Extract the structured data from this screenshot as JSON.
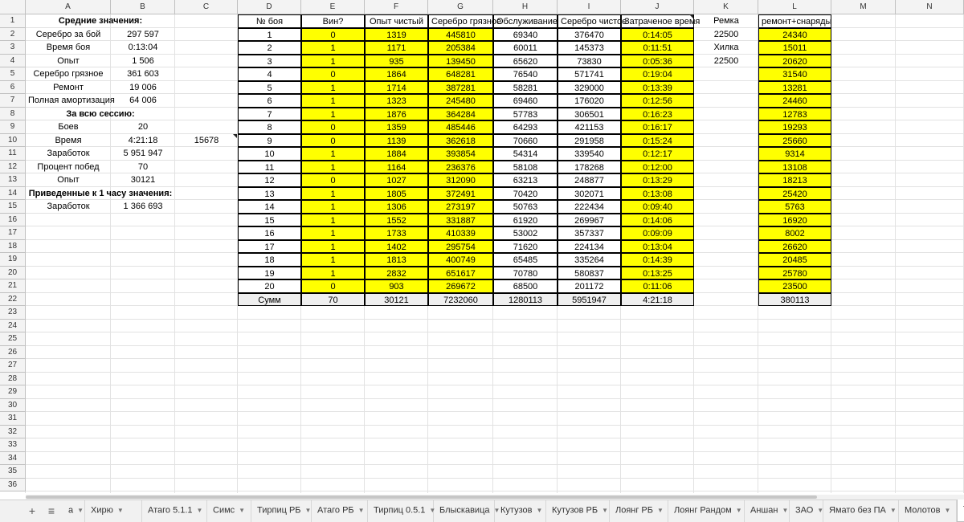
{
  "columns": [
    "A",
    "B",
    "C",
    "D",
    "E",
    "F",
    "G",
    "H",
    "I",
    "J",
    "K",
    "L",
    "M",
    "N"
  ],
  "rows": [
    "1",
    "2",
    "3",
    "4",
    "5",
    "6",
    "7",
    "8",
    "9",
    "10",
    "11",
    "12",
    "13",
    "14",
    "15",
    "16",
    "17",
    "18",
    "19",
    "20",
    "21",
    "22",
    "23",
    "24",
    "25",
    "26",
    "27",
    "28",
    "29",
    "30",
    "31",
    "32",
    "33",
    "34",
    "35",
    "36"
  ],
  "summary": {
    "avg_title": "Средние значения:",
    "avg": [
      {
        "label": "Серебро за бой",
        "value": "297 597"
      },
      {
        "label": "Время боя",
        "value": "0:13:04"
      },
      {
        "label": "Опыт",
        "value": "1 506"
      },
      {
        "label": "Серебро грязное",
        "value": "361 603"
      },
      {
        "label": "Ремонт",
        "value": "19 006"
      },
      {
        "label": "Полная амортизация",
        "value": "64 006"
      }
    ],
    "session_title": "За всю сессию:",
    "session": [
      {
        "label": "Боев",
        "value": "20"
      },
      {
        "label": "Время",
        "value": "4:21:18"
      },
      {
        "label": "Заработок",
        "value": "5 951 947"
      },
      {
        "label": "Процент побед",
        "value": "70"
      },
      {
        "label": "Опыт",
        "value": "30121"
      }
    ],
    "extra_c10": "15678",
    "hour_title": "Приведенные к 1 часу значения:",
    "hour": [
      {
        "label": "Заработок",
        "value": "1 366 693"
      }
    ]
  },
  "table": {
    "headers": [
      "№ боя",
      "Вин?",
      "Опыт чистый",
      "Серебро грязное",
      "Обслуживание",
      "Серебро чистое",
      "Затраченое время"
    ],
    "rows": [
      [
        "1",
        "0",
        "1319",
        "445810",
        "69340",
        "376470",
        "0:14:05"
      ],
      [
        "2",
        "1",
        "1171",
        "205384",
        "60011",
        "145373",
        "0:11:51"
      ],
      [
        "3",
        "1",
        "935",
        "139450",
        "65620",
        "73830",
        "0:05:36"
      ],
      [
        "4",
        "0",
        "1864",
        "648281",
        "76540",
        "571741",
        "0:19:04"
      ],
      [
        "5",
        "1",
        "1714",
        "387281",
        "58281",
        "329000",
        "0:13:39"
      ],
      [
        "6",
        "1",
        "1323",
        "245480",
        "69460",
        "176020",
        "0:12:56"
      ],
      [
        "7",
        "1",
        "1876",
        "364284",
        "57783",
        "306501",
        "0:16:23"
      ],
      [
        "8",
        "0",
        "1359",
        "485446",
        "64293",
        "421153",
        "0:16:17"
      ],
      [
        "9",
        "0",
        "1139",
        "362618",
        "70660",
        "291958",
        "0:15:24"
      ],
      [
        "10",
        "1",
        "1884",
        "393854",
        "54314",
        "339540",
        "0:12:17"
      ],
      [
        "11",
        "1",
        "1164",
        "236376",
        "58108",
        "178268",
        "0:12:00"
      ],
      [
        "12",
        "0",
        "1027",
        "312090",
        "63213",
        "248877",
        "0:13:29"
      ],
      [
        "13",
        "1",
        "1805",
        "372491",
        "70420",
        "302071",
        "0:13:08"
      ],
      [
        "14",
        "1",
        "1306",
        "273197",
        "50763",
        "222434",
        "0:09:40"
      ],
      [
        "15",
        "1",
        "1552",
        "331887",
        "61920",
        "269967",
        "0:14:06"
      ],
      [
        "16",
        "1",
        "1733",
        "410339",
        "53002",
        "357337",
        "0:09:09"
      ],
      [
        "17",
        "1",
        "1402",
        "295754",
        "71620",
        "224134",
        "0:13:04"
      ],
      [
        "18",
        "1",
        "1813",
        "400749",
        "65485",
        "335264",
        "0:14:39"
      ],
      [
        "19",
        "1",
        "2832",
        "651617",
        "70780",
        "580837",
        "0:13:25"
      ],
      [
        "20",
        "0",
        "903",
        "269672",
        "68500",
        "201172",
        "0:11:06"
      ]
    ],
    "totals": [
      "Сумм",
      "70",
      "30121",
      "7232060",
      "1280113",
      "5951947",
      "4:21:18"
    ]
  },
  "side": {
    "k_header": "Ремка",
    "k_values": [
      "22500",
      "Хилка",
      "22500"
    ],
    "l_header": "ремонт+снаряды",
    "l_values": [
      "24340",
      "15011",
      "20620",
      "31540",
      "13281",
      "24460",
      "12783",
      "19293",
      "25660",
      "9314",
      "13108",
      "18213",
      "25420",
      "5763",
      "16920",
      "8002",
      "26620",
      "20485",
      "25780",
      "23500"
    ],
    "l_total": "380113"
  },
  "tabs": [
    "а",
    "Хирю",
    "Атаго 5.1.1",
    "Симс",
    "Тирпиц РБ",
    "Атаго РБ",
    "Тирпиц 0.5.1",
    "Блыскавица",
    "Кутузов",
    "Кутузов РБ",
    "Лоянг РБ",
    "Лоянг Рандом",
    "Аншан",
    "ЗАО",
    "Ямато без ПА",
    "Молотов",
    "Texac"
  ],
  "active_tab": "Texac",
  "icons": {
    "add": "plus-icon",
    "list": "list-icon",
    "arrow": "dropdown-arrow-icon"
  },
  "colors": {
    "highlight": "#ffff00",
    "header_bg": "#f3f3f3",
    "totals_bg": "#efefef"
  }
}
